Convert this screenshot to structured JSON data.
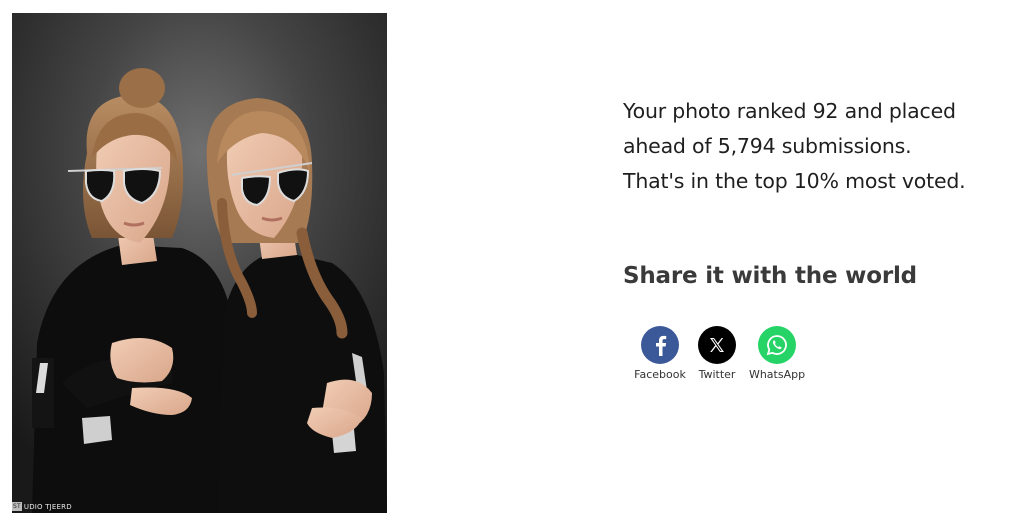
{
  "photo": {
    "watermark_mark": "ST",
    "watermark_text": "UDIO TJEERD"
  },
  "stats": {
    "line1": "Your photo ranked 92 and placed",
    "line2": "ahead of 5,794 submissions.",
    "line3": "That's in the top 10% most voted."
  },
  "share": {
    "heading": "Share it with the world",
    "buttons": [
      {
        "label": "Facebook",
        "icon": "facebook-icon",
        "color": "#3b5998"
      },
      {
        "label": "Twitter",
        "icon": "x-icon",
        "color": "#000000"
      },
      {
        "label": "WhatsApp",
        "icon": "whatsapp-icon",
        "color": "#25d366"
      }
    ]
  }
}
